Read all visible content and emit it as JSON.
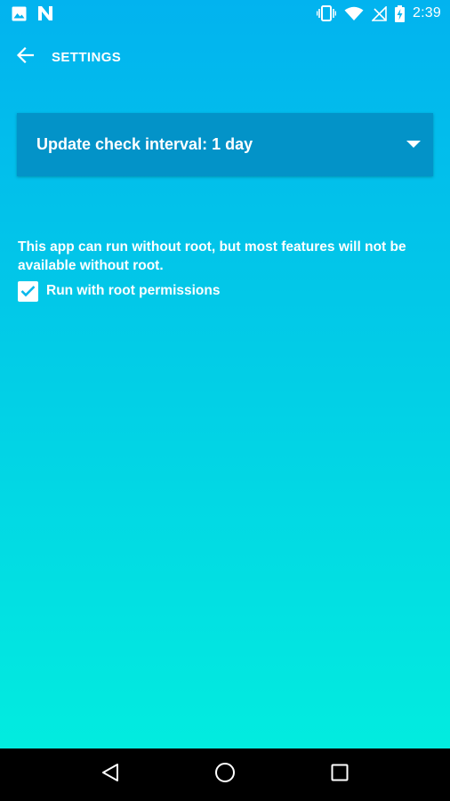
{
  "status_bar": {
    "time": "2:39",
    "left_icons": [
      "image-icon",
      "n-logo-icon"
    ],
    "right_icons": [
      "vibrate-icon",
      "wifi-icon",
      "no-signal-icon",
      "battery-charging-icon"
    ]
  },
  "toolbar": {
    "back_icon": "arrow-left-icon",
    "title": "SETTINGS"
  },
  "update_interval": {
    "label": "Update check interval: 1 day"
  },
  "root": {
    "notice": "This app can run without root, but most features will not be available without root.",
    "checkbox_label": "Run with root permissions",
    "checked": true
  },
  "nav_bar": {
    "buttons": [
      "back-triangle-icon",
      "home-circle-icon",
      "recents-square-icon"
    ]
  },
  "colors": {
    "gradient_top": "#02b3ef",
    "gradient_bottom": "#02ecdf",
    "dropdown_bg": "#0393c8",
    "text": "#ffffff"
  }
}
